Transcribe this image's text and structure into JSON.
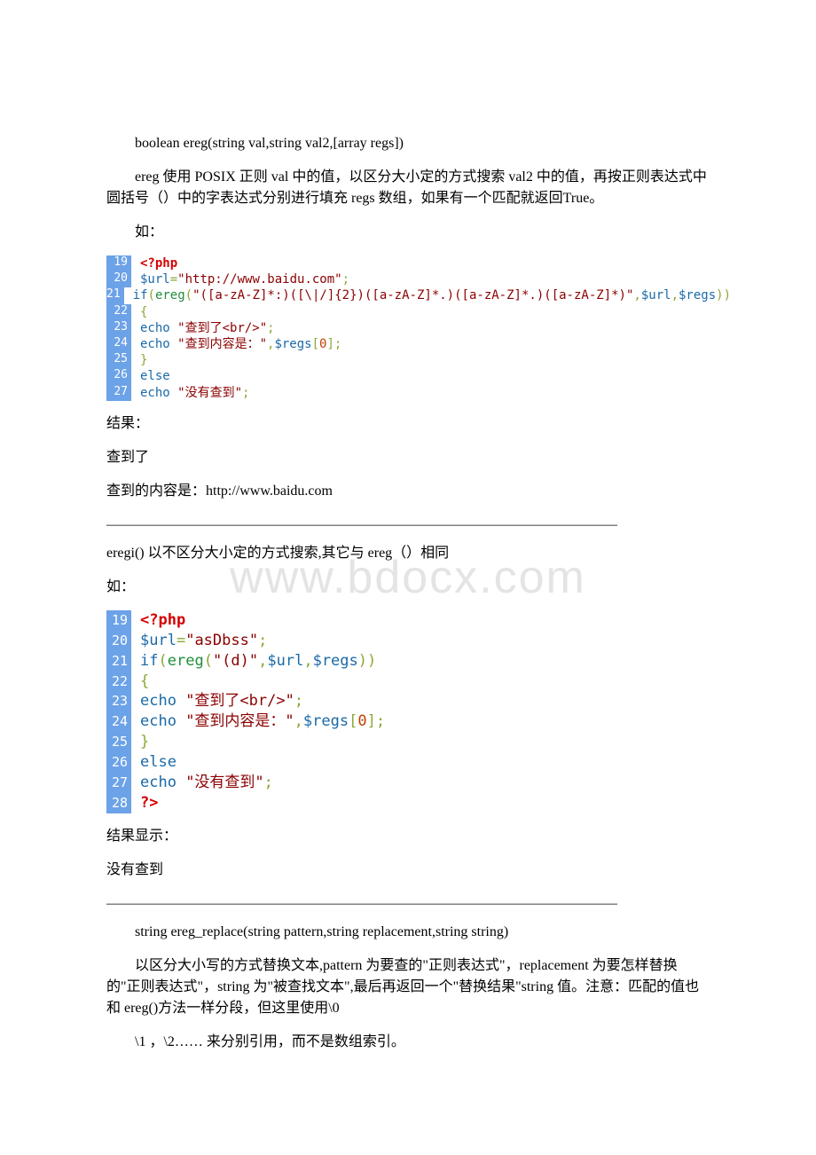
{
  "watermark": "www.bdocx.com",
  "p1": "boolean ereg(string val,string val2,[array regs])",
  "p2": "ereg 使用 POSIX 正则 val 中的值，以区分大小定的方式搜索 val2 中的值，再按正则表达式中圆括号（）中的字表达式分别进行填充 regs 数组，如果有一个匹配就返回True。",
  "p3": "如：",
  "code1": {
    "lines": [
      "19",
      "20",
      "21",
      "22",
      "23",
      "24",
      "25",
      "26",
      "27"
    ]
  },
  "c1l19_tag": "<?php",
  "c1l20_var": "$url",
  "c1l20_eq": "=",
  "c1l20_str": "\"http://www.baidu.com\"",
  "c1l20_semi": ";",
  "c1l21_if": "if",
  "c1l21_p1": "(",
  "c1l21_fn": "ereg",
  "c1l21_p2": "(",
  "c1l21_pat": "\"([a-zA-Z]*:)([\\|/]{2})([a-zA-Z]*.)([a-zA-Z]*.)([a-zA-Z]*)\"",
  "c1l21_c1": ",",
  "c1l21_v1": "$url",
  "c1l21_c2": ",",
  "c1l21_v2": "$regs",
  "c1l21_p3": "))",
  "c1l22": "{",
  "c1l23_e": "echo ",
  "c1l23_s": "\"查到了<br/>\"",
  "c1l23_semi": ";",
  "c1l24_e": "echo ",
  "c1l24_s": "\"查到内容是：\"",
  "c1l24_c": ",",
  "c1l24_v": "$regs",
  "c1l24_b": "[",
  "c1l24_n": "0",
  "c1l24_b2": "]",
  "c1l24_semi": ";",
  "c1l25": "}",
  "c1l26": "else",
  "c1l27_e": "echo ",
  "c1l27_s": "\"没有查到\"",
  "c1l27_semi": ";",
  "p4": "结果：",
  "p5": " 查到了",
  "p6": " 查到的内容是：http://www.baidu.com",
  "divider": "――――――――――――――――――――――――――――――――――――",
  "p7": "eregi() 以不区分大小定的方式搜索,其它与 ereg（）相同",
  "p8": "如：",
  "code2": {
    "lines": [
      "19",
      "20",
      "21",
      "22",
      "23",
      "24",
      "25",
      "26",
      "27",
      "28"
    ]
  },
  "c2l19_tag": "<?php",
  "c2l20_var": "$url",
  "c2l20_eq": "=",
  "c2l20_str": "\"asDbss\"",
  "c2l20_semi": ";",
  "c2l21_if": "if",
  "c2l21_p1": "(",
  "c2l21_fn": "ereg",
  "c2l21_p2": "(",
  "c2l21_pat": "\"(d)\"",
  "c2l21_c1": ",",
  "c2l21_v1": "$url",
  "c2l21_c2": ",",
  "c2l21_v2": "$regs",
  "c2l21_p3": "))",
  "c2l22": "{",
  "c2l23_e": "echo ",
  "c2l23_s": "\"查到了<br/>\"",
  "c2l23_semi": ";",
  "c2l24_e": "echo ",
  "c2l24_s": "\"查到内容是：\"",
  "c2l24_c": ",",
  "c2l24_v": "$regs",
  "c2l24_b": "[",
  "c2l24_n": "0",
  "c2l24_b2": "]",
  "c2l24_semi": ";",
  "c2l25": "}",
  "c2l26": "else",
  "c2l27_e": "echo ",
  "c2l27_s": "\"没有查到\"",
  "c2l27_semi": ";",
  "c2l28": "?>",
  "p9": "结果显示：",
  "p10": " 没有查到",
  "p11": "string ereg_replace(string pattern,string replacement,string string)",
  "p12": "以区分大小写的方式替换文本,pattern 为要查的\"正则表达式\"，replacement 为要怎样替换的\"正则表达式\"，string 为\"被查找文本\",最后再返回一个\"替换结果\"string 值。注意：匹配的值也和 ereg()方法一样分段，但这里使用\\0",
  "p13": "\\1 ，\\2…… 来分别引用，而不是数组索引。"
}
